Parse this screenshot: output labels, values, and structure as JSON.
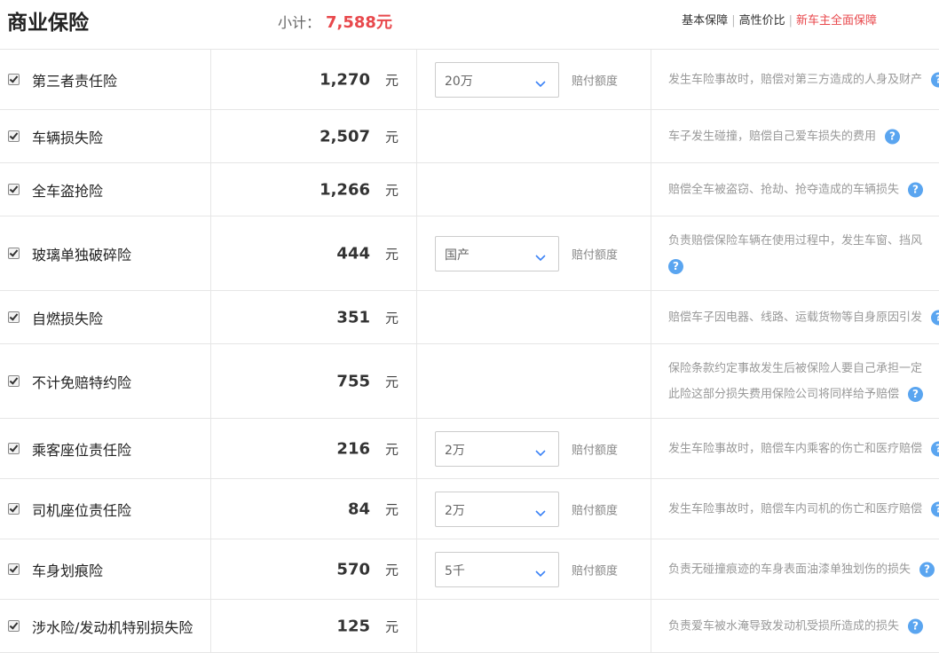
{
  "header": {
    "title": "商业保险",
    "subtotal_label": "小计：",
    "subtotal_value": "7,588元",
    "tabs": [
      "基本保障",
      "高性价比",
      "新车主全面保障"
    ]
  },
  "currency_unit": "元",
  "limit_label": "赔付额度",
  "help_glyph": "?",
  "rows": [
    {
      "name": "第三者责任险",
      "price": "1,270",
      "select": "20万",
      "desc1": "发生车险事故时，赔偿对第三方造成的人身及财产",
      "desc2": ""
    },
    {
      "name": "车辆损失险",
      "price": "2,507",
      "select": null,
      "desc1": "车子发生碰撞，赔偿自己爱车损失的费用",
      "desc2": ""
    },
    {
      "name": "全车盗抢险",
      "price": "1,266",
      "select": null,
      "desc1": "赔偿全车被盗窃、抢劫、抢夺造成的车辆损失",
      "desc2": ""
    },
    {
      "name": "玻璃单独破碎险",
      "price": "444",
      "select": "国产",
      "desc1": "负责赔偿保险车辆在使用过程中，发生车窗、挡风",
      "desc2": ""
    },
    {
      "name": "自燃损失险",
      "price": "351",
      "select": null,
      "desc1": "赔偿车子因电器、线路、运载货物等自身原因引发",
      "desc2": ""
    },
    {
      "name": "不计免赔特约险",
      "price": "755",
      "select": null,
      "desc1": "保险条款约定事故发生后被保险人要自己承担一定",
      "desc2": "此险这部分损失费用保险公司将同样给予赔偿"
    },
    {
      "name": "乘客座位责任险",
      "price": "216",
      "select": "2万",
      "desc1": "发生车险事故时，赔偿车内乘客的伤亡和医疗赔偿",
      "desc2": ""
    },
    {
      "name": "司机座位责任险",
      "price": "84",
      "select": "2万",
      "desc1": "发生车险事故时，赔偿车内司机的伤亡和医疗赔偿",
      "desc2": ""
    },
    {
      "name": "车身划痕险",
      "price": "570",
      "select": "5千",
      "desc1": "负责无碰撞痕迹的车身表面油漆单独划伤的损失",
      "desc2": ""
    },
    {
      "name": "涉水险/发动机特别损失险",
      "price": "125",
      "select": null,
      "desc1": "负责爱车被水淹导致发动机受损所造成的损失",
      "desc2": ""
    }
  ],
  "colors": {
    "accent": "#e8484c",
    "help": "#5aa5f0",
    "border": "#e6e6e6"
  }
}
